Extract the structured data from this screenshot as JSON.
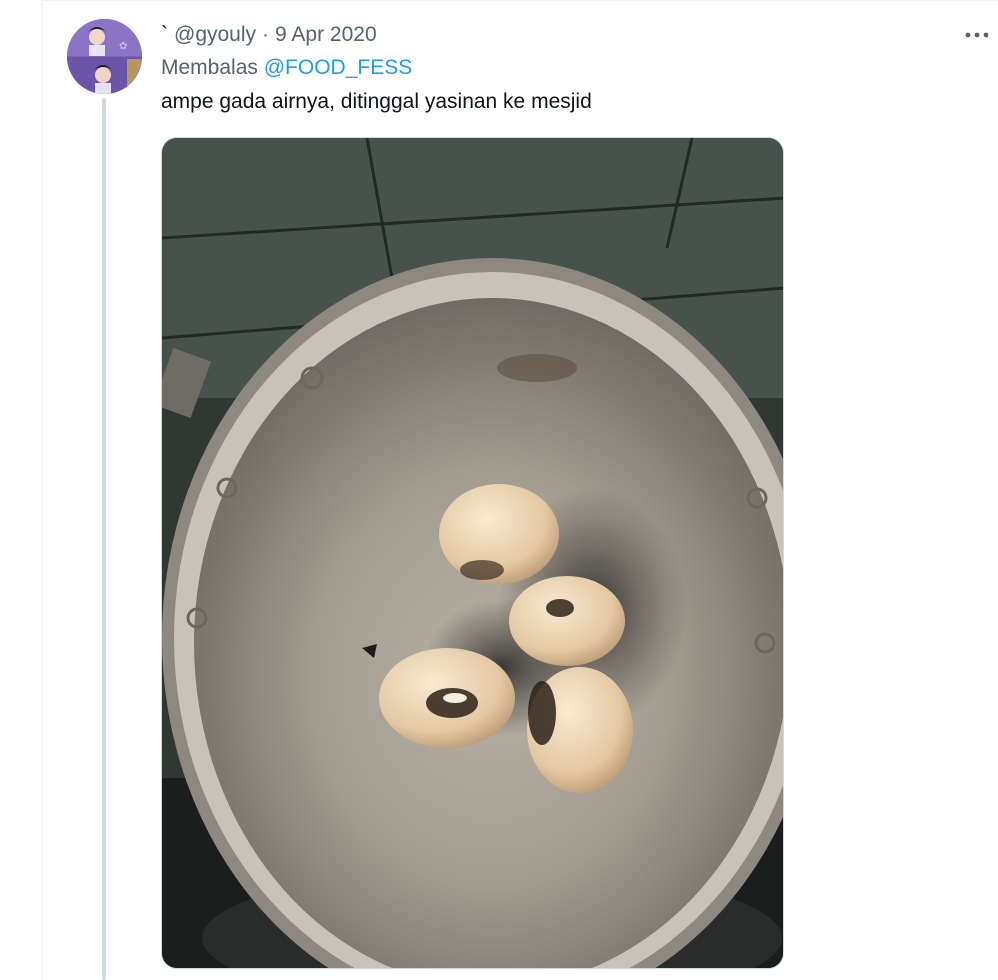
{
  "tweet": {
    "display_name": "`",
    "handle": "@gyouly",
    "separator": "·",
    "date": "9 Apr 2020",
    "reply_prefix": "Membalas",
    "reply_handle": "@FOOD_FESS",
    "text": "ampe gada airnya, ditinggal yasinan ke mesjid",
    "more_icon": "more-horizontal-icon",
    "media": {
      "type": "photo",
      "alt": ""
    }
  },
  "colors": {
    "text_primary": "#0f1419",
    "text_secondary": "#536471",
    "link": "#1d9bf0",
    "thread_line": "#cfd9de",
    "border": "#eff3f4"
  }
}
